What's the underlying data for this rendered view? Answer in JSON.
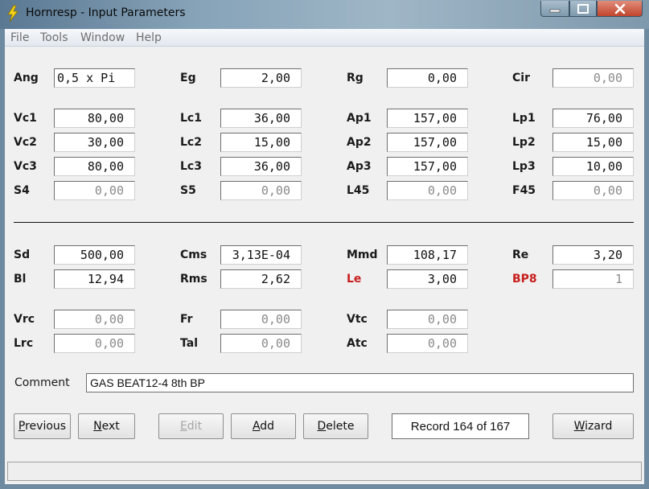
{
  "window": {
    "title": "Hornresp - Input Parameters",
    "app_icon": "lightning-bolt-icon",
    "controls": [
      "minimize-icon",
      "maximize-icon",
      "close-icon"
    ]
  },
  "menu": [
    "File",
    "Tools",
    "Window",
    "Help"
  ],
  "top_section": [
    [
      {
        "label": "Ang",
        "value": "0,5 x Pi",
        "enabled": true,
        "align": "left"
      },
      {
        "label": "Eg",
        "value": "2,00",
        "enabled": true
      },
      {
        "label": "Rg",
        "value": "0,00",
        "enabled": true
      },
      {
        "label": "Cir",
        "value": "0,00",
        "enabled": false
      }
    ],
    [
      {
        "label": "Vc1",
        "value": "80,00",
        "enabled": true
      },
      {
        "label": "Lc1",
        "value": "36,00",
        "enabled": true
      },
      {
        "label": "Ap1",
        "value": "157,00",
        "enabled": true
      },
      {
        "label": "Lp1",
        "value": "76,00",
        "enabled": true
      }
    ],
    [
      {
        "label": "Vc2",
        "value": "30,00",
        "enabled": true
      },
      {
        "label": "Lc2",
        "value": "15,00",
        "enabled": true
      },
      {
        "label": "Ap2",
        "value": "157,00",
        "enabled": true
      },
      {
        "label": "Lp2",
        "value": "15,00",
        "enabled": true
      }
    ],
    [
      {
        "label": "Vc3",
        "value": "80,00",
        "enabled": true
      },
      {
        "label": "Lc3",
        "value": "36,00",
        "enabled": true
      },
      {
        "label": "Ap3",
        "value": "157,00",
        "enabled": true
      },
      {
        "label": "Lp3",
        "value": "10,00",
        "enabled": true
      }
    ],
    [
      {
        "label": "S4",
        "value": "0,00",
        "enabled": false
      },
      {
        "label": "S5",
        "value": "0,00",
        "enabled": false
      },
      {
        "label": "L45",
        "value": "0,00",
        "enabled": false
      },
      {
        "label": "F45",
        "value": "0,00",
        "enabled": false
      }
    ]
  ],
  "driver_section": [
    [
      {
        "label": "Sd",
        "value": "500,00",
        "enabled": true
      },
      {
        "label": "Cms",
        "value": "3,13E-04",
        "enabled": true
      },
      {
        "label": "Mmd",
        "value": "108,17",
        "enabled": true
      },
      {
        "label": "Re",
        "value": "3,20",
        "enabled": true
      }
    ],
    [
      {
        "label": "Bl",
        "value": "12,94",
        "enabled": true
      },
      {
        "label": "Rms",
        "value": "2,62",
        "enabled": true
      },
      {
        "label": "Le",
        "value": "3,00",
        "enabled": true,
        "label_color": "#c81e1e"
      },
      {
        "label": "BP8",
        "value": "1",
        "enabled": false,
        "label_color": "#c81e1e"
      }
    ],
    [
      {
        "label": "Vrc",
        "value": "0,00",
        "enabled": false
      },
      {
        "label": "Fr",
        "value": "0,00",
        "enabled": false
      },
      {
        "label": "Vtc",
        "value": "0,00",
        "enabled": false
      }
    ],
    [
      {
        "label": "Lrc",
        "value": "0,00",
        "enabled": false
      },
      {
        "label": "Tal",
        "value": "0,00",
        "enabled": false
      },
      {
        "label": "Atc",
        "value": "0,00",
        "enabled": false
      }
    ]
  ],
  "comment": {
    "label": "Comment",
    "value": "GAS BEAT12-4 8th BP"
  },
  "buttons": {
    "previous": "Previous",
    "next": "Next",
    "edit": "Edit",
    "add": "Add",
    "delete": "Delete",
    "wizard": "Wizard"
  },
  "record_status": "Record 164 of 167",
  "status_text": ""
}
